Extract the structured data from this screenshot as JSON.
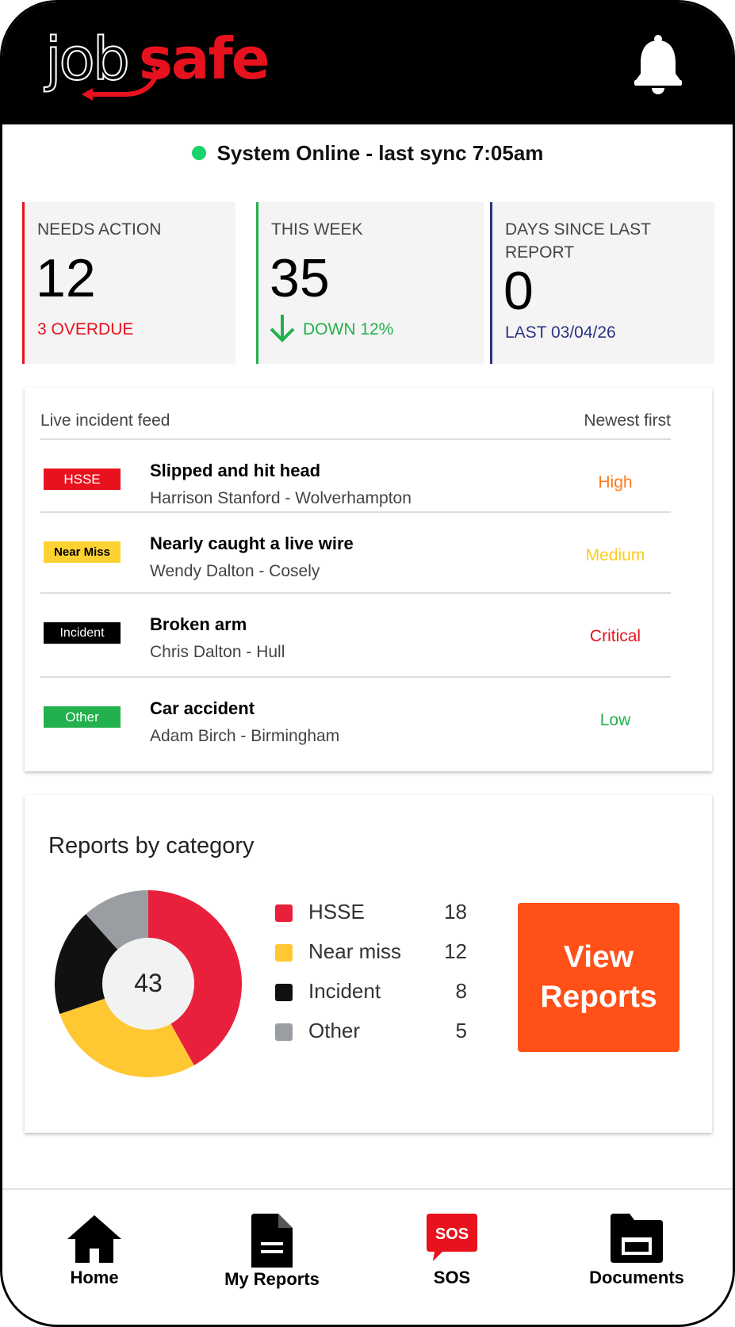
{
  "app": {
    "logo_part1": "job",
    "logo_part2": "safe"
  },
  "status": {
    "text": "System Online - last sync 7:05am",
    "color": "#19d36c"
  },
  "stats": [
    {
      "label": "NEEDS ACTION",
      "value": "12",
      "sub": "3 OVERDUE",
      "accent": "#e8121e"
    },
    {
      "label": "THIS WEEK",
      "value": "35",
      "sub": "DOWN 12%",
      "accent": "#22b14c"
    },
    {
      "label": "DAYS SINCE LAST REPORT",
      "value": "0",
      "sub": "LAST 03/04/26",
      "accent": "#2a3480"
    }
  ],
  "feed": {
    "title": "Live incident feed",
    "sort": "Newest first",
    "items": [
      {
        "tag": "HSSE",
        "tag_bg": "#e8121e",
        "tag_fg": "#ffffff",
        "title": "Slipped and hit head",
        "meta": "Harrison Stanford - Wolverhampton",
        "severity": "High",
        "severity_color": "#ff7a1a"
      },
      {
        "tag": "Near Miss",
        "tag_bg": "#ffd233",
        "tag_fg": "#000000",
        "title": "Nearly caught a live wire",
        "meta": "Wendy Dalton - Cosely",
        "severity": "Medium",
        "severity_color": "#ffcc1a"
      },
      {
        "tag": "Incident",
        "tag_bg": "#000000",
        "tag_fg": "#ffffff",
        "title": "Broken arm",
        "meta": "Chris Dalton - Hull",
        "severity": "Critical",
        "severity_color": "#e8121e"
      },
      {
        "tag": "Other",
        "tag_bg": "#22b14c",
        "tag_fg": "#ffffff",
        "title": "Car accident",
        "meta": "Adam Birch - Birmingham",
        "severity": "Low",
        "severity_color": "#22b14c"
      }
    ]
  },
  "categories": {
    "title": "Reports by category",
    "total": "43",
    "view_button_line1": "View",
    "view_button_line2": "Reports",
    "legend": [
      {
        "name": "HSSE",
        "count": "18",
        "color": "#e8203c"
      },
      {
        "name": "Near miss",
        "count": "12",
        "color": "#ffc833"
      },
      {
        "name": "Incident",
        "count": "8",
        "color": "#111111"
      },
      {
        "name": "Other",
        "count": "5",
        "color": "#9a9ea3"
      }
    ]
  },
  "chart_data": {
    "type": "pie",
    "title": "Reports by category",
    "categories": [
      "HSSE",
      "Near miss",
      "Incident",
      "Other"
    ],
    "values": [
      18,
      12,
      8,
      5
    ],
    "colors": [
      "#e8203c",
      "#ffc833",
      "#111111",
      "#9a9ea3"
    ],
    "total": 43,
    "legend": "right"
  },
  "nav": {
    "items": [
      {
        "label": "Home",
        "icon": "home-icon"
      },
      {
        "label": "My Reports",
        "icon": "document-icon"
      },
      {
        "label": "SOS",
        "icon": "sos-icon",
        "icon_text": "SOS"
      },
      {
        "label": "Documents",
        "icon": "folder-icon"
      }
    ]
  },
  "icons": {
    "bell": "bell-icon",
    "status_dot": "status-dot-icon",
    "down_arrow": "arrow-down-icon"
  }
}
